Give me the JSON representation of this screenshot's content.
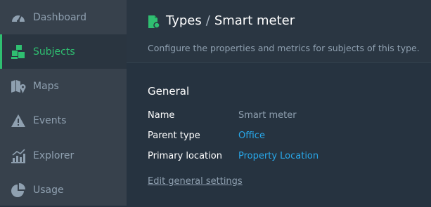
{
  "sidebar": {
    "items": [
      {
        "label": "Dashboard",
        "icon": "gauge-icon"
      },
      {
        "label": "Subjects",
        "icon": "subjects-icon",
        "active": true
      },
      {
        "label": "Maps",
        "icon": "map-icon"
      },
      {
        "label": "Events",
        "icon": "warning-icon"
      },
      {
        "label": "Explorer",
        "icon": "chart-icon"
      },
      {
        "label": "Usage",
        "icon": "pie-icon"
      }
    ]
  },
  "header": {
    "breadcrumb_parent": "Types",
    "separator": "/",
    "breadcrumb_current": "Smart meter",
    "subtitle": "Configure the properties and metrics for subjects of this type."
  },
  "general": {
    "title": "General",
    "rows": [
      {
        "label": "Name",
        "value": "Smart meter"
      },
      {
        "label": "Parent type",
        "value": "Office"
      },
      {
        "label": "Primary location",
        "value": "Property Location"
      }
    ],
    "edit_label": "Edit general settings"
  },
  "colors": {
    "accent_green": "#2fbf71",
    "link_blue": "#28a8ea",
    "sidebar_bg": "#37414c",
    "main_bg": "#263340"
  }
}
